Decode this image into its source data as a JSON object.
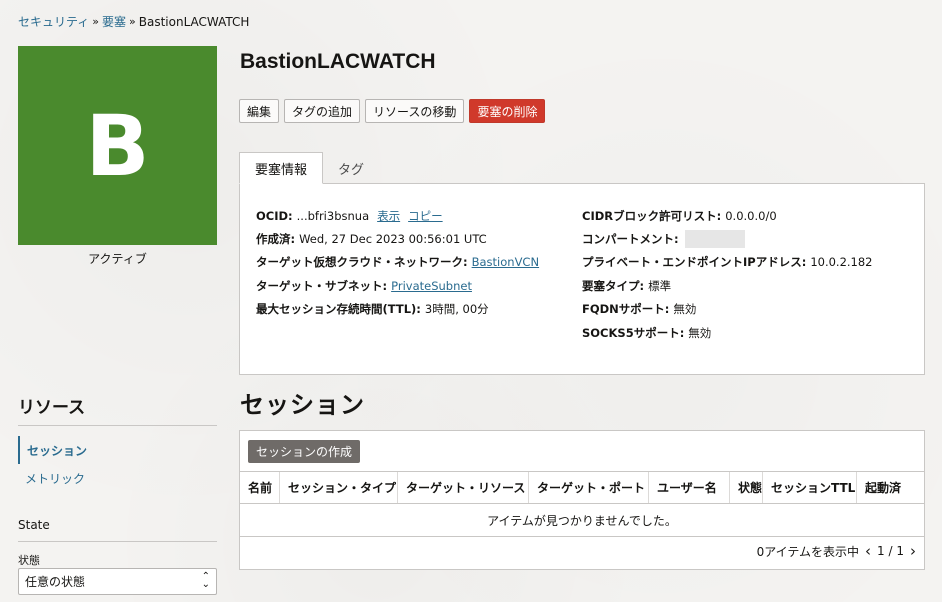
{
  "breadcrumb": [
    {
      "label": "セキュリティ"
    },
    {
      "label": "要塞"
    },
    {
      "label": "BastionLACWATCH"
    }
  ],
  "avatar": {
    "letter": "B",
    "color": "#4a8a2d",
    "status": "アクティブ"
  },
  "page_title": "BastionLACWATCH",
  "actions": {
    "edit": "編集",
    "add_tag": "タグの追加",
    "move": "リソースの移動",
    "delete": "要塞の削除"
  },
  "tabs": [
    {
      "label": "要塞情報",
      "active": true
    },
    {
      "label": "タグ",
      "active": false
    }
  ],
  "info": {
    "left": [
      {
        "key": "OCID:",
        "value": "...bfri3bsnua",
        "show": "表示",
        "copy": "コピー"
      },
      {
        "key": "作成済:",
        "value": "Wed, 27 Dec 2023 00:56:01 UTC"
      },
      {
        "key": "ターゲット仮想クラウド・ネットワーク:",
        "link": "BastionVCN"
      },
      {
        "key": "ターゲット・サブネット:",
        "link": "PrivateSubnet"
      },
      {
        "key": "最大セッション存続時間(TTL):",
        "value": "3時間, 00分"
      }
    ],
    "right": [
      {
        "key": "CIDRブロック許可リスト:",
        "value": "0.0.0.0/0"
      },
      {
        "key": "コンパートメント:",
        "value": ""
      },
      {
        "key": "プライベート・エンドポイントIPアドレス:",
        "value": "10.0.2.182"
      },
      {
        "key": "要塞タイプ:",
        "value": "標準"
      },
      {
        "key": "FQDNサポート:",
        "value": "無効"
      },
      {
        "key": "SOCKS5サポート:",
        "value": "無効"
      }
    ]
  },
  "resources": {
    "title": "リソース",
    "items": [
      {
        "label": "セッション",
        "active": true
      },
      {
        "label": "メトリック",
        "active": false
      }
    ]
  },
  "state": {
    "title": "State",
    "filter_label": "状態",
    "filter_value": "任意の状態"
  },
  "sessions": {
    "title": "セッション",
    "create_label": "セッションの作成",
    "columns": [
      "名前",
      "セッション・タイプ",
      "ターゲット・リソース",
      "ターゲット・ポート",
      "ユーザー名",
      "状態",
      "セッションTTL",
      "起動済"
    ],
    "empty_message": "アイテムが見つかりませんでした。",
    "showing": "0アイテムを表示中",
    "page": "1 / 1"
  },
  "colors": {
    "link": "#2a6b8f",
    "danger": "#d0392b",
    "avatar": "#4a8a2d"
  }
}
